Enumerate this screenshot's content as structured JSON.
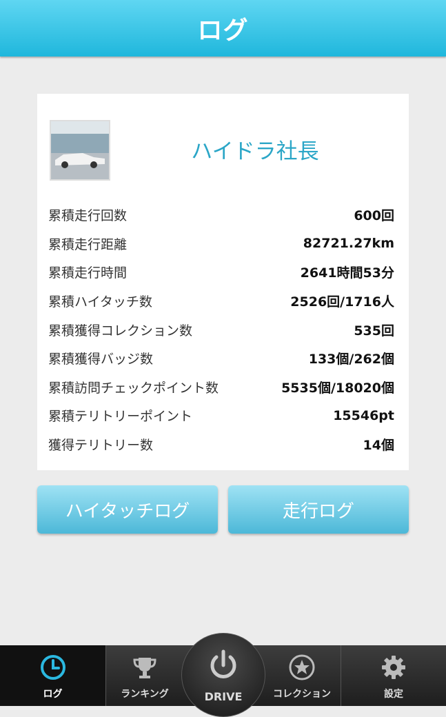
{
  "header": {
    "title": "ログ"
  },
  "profile": {
    "name": "ハイドラ社長"
  },
  "stats": [
    {
      "label": "累積走行回数",
      "value": "600回"
    },
    {
      "label": "累積走行距離",
      "value": "82721.27km"
    },
    {
      "label": "累積走行時間",
      "value": "2641時間53分"
    },
    {
      "label": "累積ハイタッチ数",
      "value": "2526回/1716人"
    },
    {
      "label": "累積獲得コレクション数",
      "value": "535回"
    },
    {
      "label": "累積獲得バッジ数",
      "value": "133個/262個"
    },
    {
      "label": "累積訪問チェックポイント数",
      "value": "5535個/18020個"
    },
    {
      "label": "累積テリトリーポイント",
      "value": "15546pt"
    },
    {
      "label": "獲得テリトリー数",
      "value": "14個"
    }
  ],
  "buttons": {
    "hightouch_log": "ハイタッチログ",
    "drive_log": "走行ログ"
  },
  "tabbar": {
    "log": "ログ",
    "ranking": "ランキング",
    "drive": "DRIVE",
    "collection": "コレクション",
    "settings": "設定"
  },
  "colors": {
    "accent": "#1fb7dc",
    "username": "#2ba6c7"
  }
}
